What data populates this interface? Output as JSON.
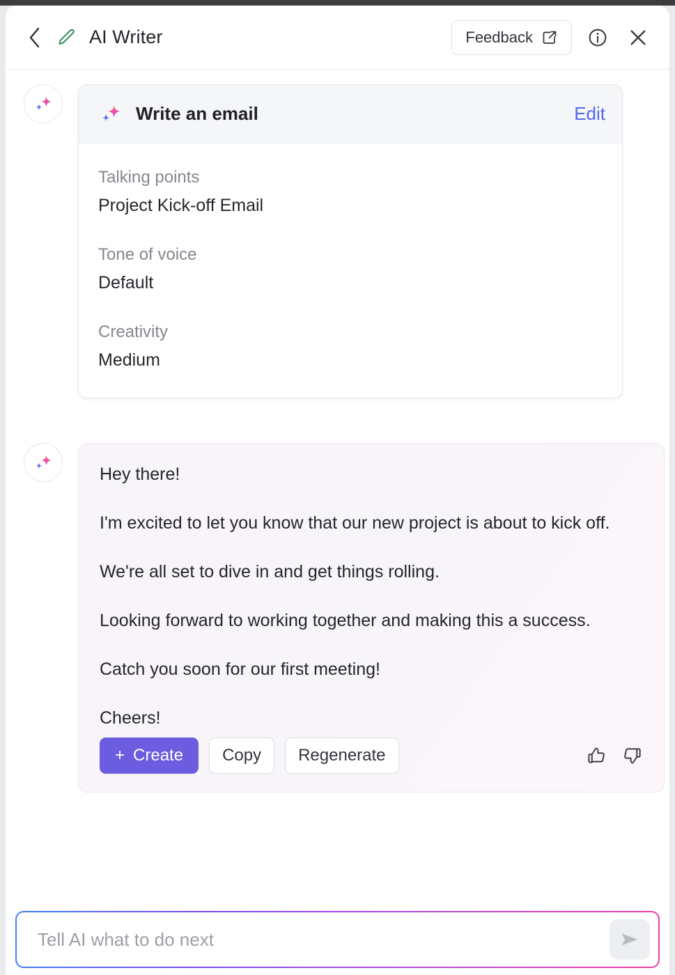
{
  "header": {
    "back_icon": "chevron-left-icon",
    "pencil_icon": "pencil-icon",
    "title": "AI Writer",
    "feedback_label": "Feedback",
    "feedback_icon": "external-link-icon",
    "info_icon": "info-circle-icon",
    "close_icon": "close-icon"
  },
  "prompt": {
    "avatar_icon": "sparkle-icon",
    "icon": "sparkle-icon",
    "title": "Write an email",
    "edit_label": "Edit",
    "fields": [
      {
        "label": "Talking points",
        "value": "Project Kick-off Email"
      },
      {
        "label": "Tone of voice",
        "value": "Default"
      },
      {
        "label": "Creativity",
        "value": "Medium"
      }
    ]
  },
  "answer": {
    "avatar_icon": "sparkle-icon",
    "paragraphs": [
      "Hey there!",
      "I'm excited to let you know that our new project is about to kick off.",
      "We're all set to dive in and get things rolling.",
      "Looking forward to working together and making this a success.",
      "Catch you soon for our first meeting!",
      "Cheers!"
    ],
    "actions": {
      "create_label": "Create",
      "create_prefix": "+",
      "copy_label": "Copy",
      "regenerate_label": "Regenerate",
      "thumbs_up_icon": "thumbs-up-icon",
      "thumbs_down_icon": "thumbs-down-icon"
    }
  },
  "composer": {
    "placeholder": "Tell AI what to do next",
    "value": "",
    "send_icon": "send-icon"
  },
  "colors": {
    "accent_purple": "#6c5ce0",
    "link_blue": "#5667f0",
    "pencil_green": "#3f8f5f",
    "sparkle_pink": "#ee4fa0",
    "sparkle_orange": "#f59a5a",
    "sparkle_violet": "#6a5ae0"
  }
}
